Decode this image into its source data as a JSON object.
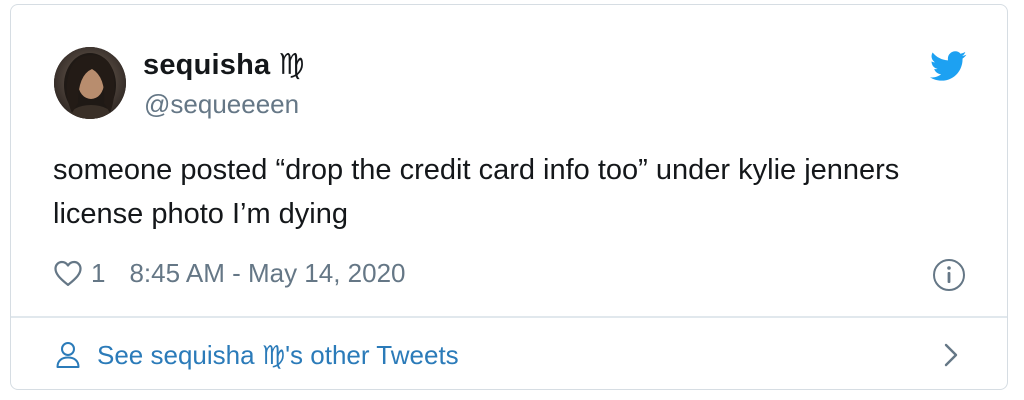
{
  "tweet": {
    "display_name": "sequisha ♍︎",
    "handle": "@sequeeeen",
    "text": "someone posted “drop the credit card info too” under kylie jenners license photo I’m dying",
    "like_count": "1",
    "timestamp": "8:45 AM - May 14, 2020"
  },
  "footer": {
    "link_label": "See sequisha ♍︎'s other Tweets"
  },
  "icons": {
    "brand": "twitter-bird-icon",
    "like": "heart-icon",
    "info": "info-icon",
    "profile": "person-icon",
    "chevron": "chevron-right-icon"
  },
  "colors": {
    "brand_blue": "#1da1f2",
    "link_blue": "#2b7bb9",
    "text_primary": "#14171a",
    "text_secondary": "#657786",
    "border": "#d6dde3"
  }
}
